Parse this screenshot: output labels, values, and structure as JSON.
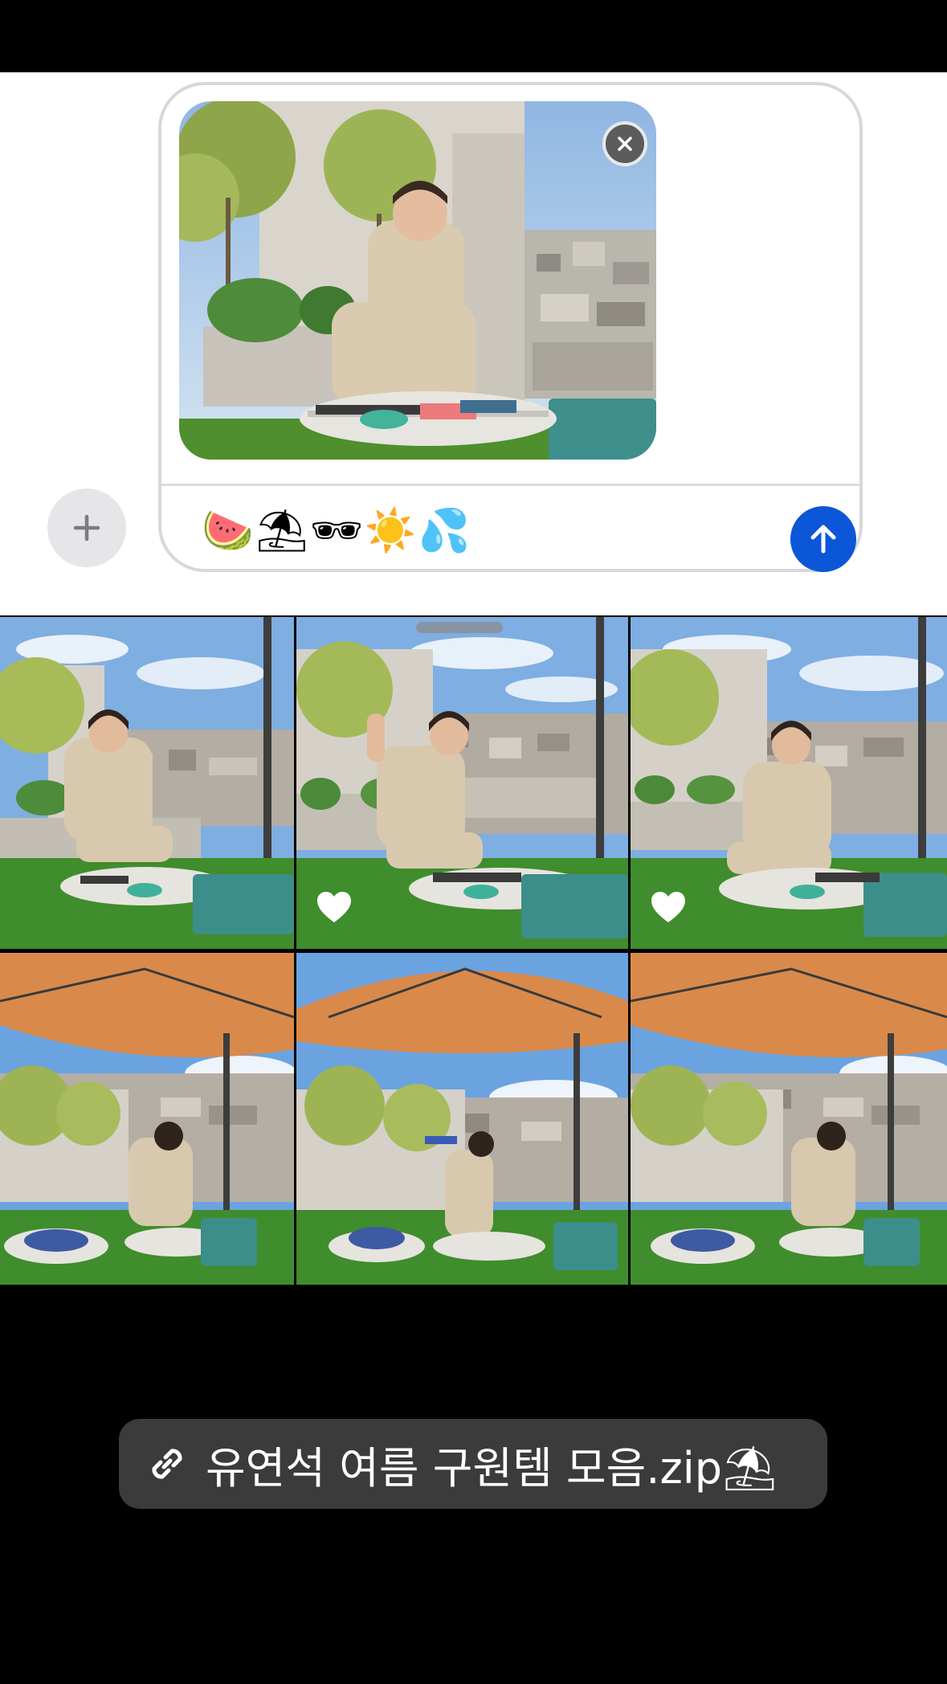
{
  "composer": {
    "message_text": "🍉⛱🕶☀️💦",
    "attachment": {
      "description_icon": "photo-attachment"
    },
    "icons": {
      "add": "plus-icon",
      "remove_attachment": "close-icon",
      "send": "arrow-up-icon"
    }
  },
  "photo_grid": {
    "thumbnails": [
      {
        "label": "photo-1",
        "favorite": false
      },
      {
        "label": "photo-2",
        "favorite": true
      },
      {
        "label": "photo-3",
        "favorite": true
      },
      {
        "label": "photo-4",
        "favorite": false
      },
      {
        "label": "photo-5",
        "favorite": false
      },
      {
        "label": "photo-6",
        "favorite": false
      }
    ]
  },
  "link_banner": {
    "icon": "link-icon",
    "label": "유연석 여름 구원템 모음.zip⛱"
  },
  "colors": {
    "send_button": "#0b57d8",
    "composer_background": "#ffffff",
    "page_background": "#000000",
    "link_pill": "#3b3b3b"
  }
}
